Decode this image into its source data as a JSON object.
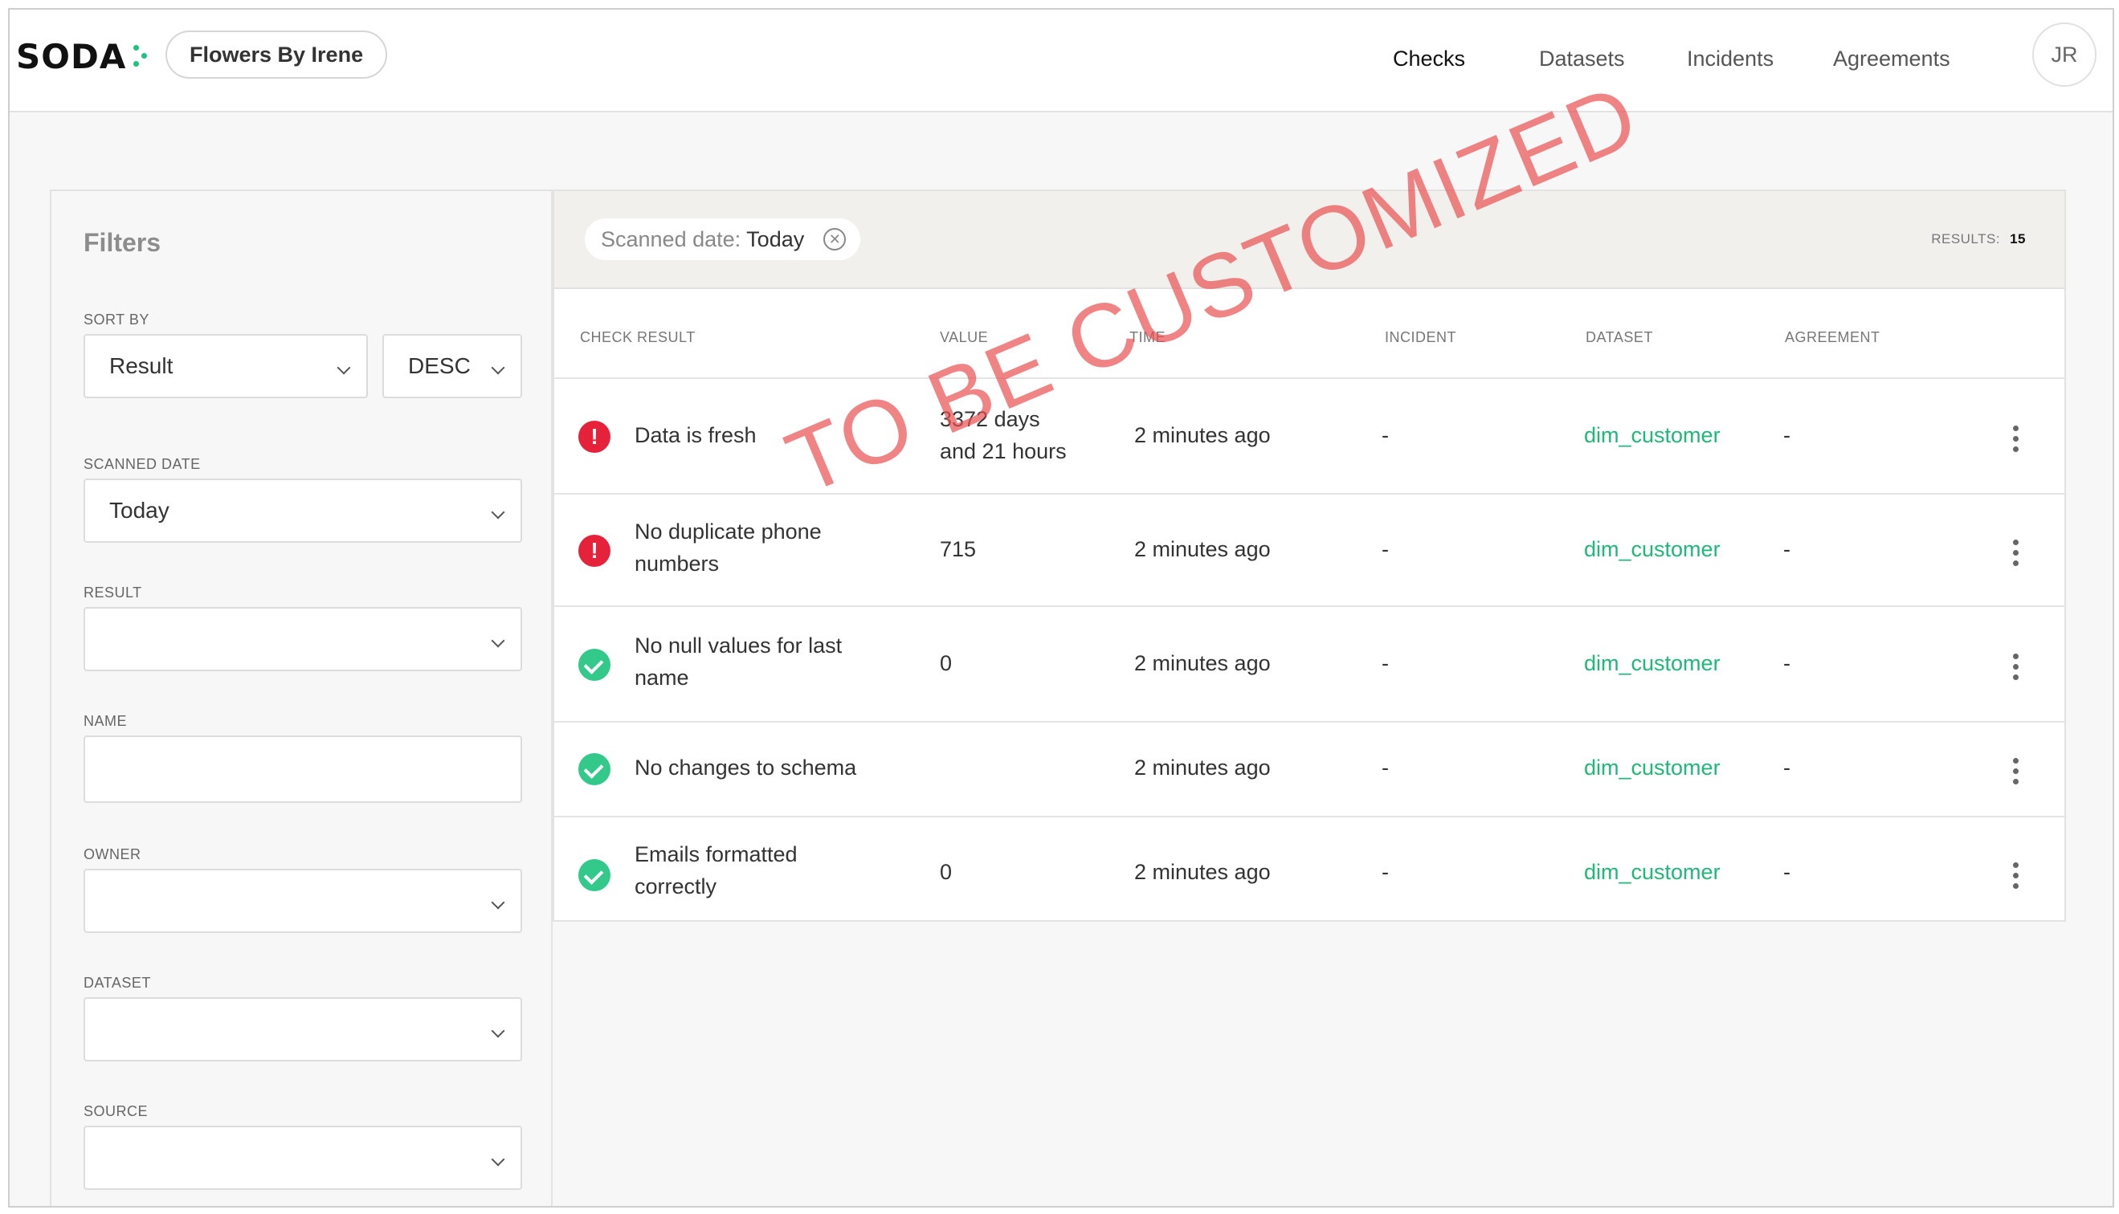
{
  "header": {
    "logo": "SODA",
    "org": "Flowers By Irene",
    "nav": [
      "Checks",
      "Datasets",
      "Incidents",
      "Agreements"
    ],
    "active_nav": "Checks",
    "avatar": "JR"
  },
  "filters": {
    "title": "Filters",
    "sort_by": {
      "label": "SORT BY",
      "field": "Result",
      "order": "DESC"
    },
    "scanned_date": {
      "label": "SCANNED DATE",
      "value": "Today"
    },
    "result": {
      "label": "RESULT",
      "value": ""
    },
    "name": {
      "label": "NAME",
      "value": ""
    },
    "owner": {
      "label": "OWNER",
      "value": ""
    },
    "dataset": {
      "label": "DATASET",
      "value": ""
    },
    "source": {
      "label": "SOURCE",
      "value": ""
    }
  },
  "results": {
    "chip": {
      "key": "Scanned date:",
      "value": "Today",
      "remove_icon": "close-circle-icon"
    },
    "count_label": "RESULTS:",
    "count": "15",
    "columns": [
      "CHECK RESULT",
      "VALUE",
      "TIME",
      "INCIDENT",
      "DATASET",
      "AGREEMENT"
    ],
    "rows": [
      {
        "status": "fail",
        "name_l1": "Data is fresh",
        "name_l2": "",
        "value_l1": "3372 days",
        "value_l2": "and 21 hours",
        "time": "2 minutes ago",
        "incident": "-",
        "dataset": "dim_customer",
        "agreement": "-"
      },
      {
        "status": "fail",
        "name_l1": "No duplicate phone",
        "name_l2": "numbers",
        "value_l1": "715",
        "value_l2": "",
        "time": "2 minutes ago",
        "incident": "-",
        "dataset": "dim_customer",
        "agreement": "-"
      },
      {
        "status": "pass",
        "name_l1": "No null values for last",
        "name_l2": "name",
        "value_l1": "0",
        "value_l2": "",
        "time": "2 minutes ago",
        "incident": "-",
        "dataset": "dim_customer",
        "agreement": "-"
      },
      {
        "status": "pass",
        "name_l1": "No changes to schema",
        "name_l2": "",
        "value_l1": "",
        "value_l2": "",
        "time": "2 minutes ago",
        "incident": "-",
        "dataset": "dim_customer",
        "agreement": "-"
      },
      {
        "status": "pass",
        "name_l1": "Emails formatted",
        "name_l2": "correctly",
        "value_l1": "0",
        "value_l2": "",
        "time": "2 minutes ago",
        "incident": "-",
        "dataset": "dim_customer",
        "agreement": "-"
      }
    ]
  },
  "watermark": "TO BE CUSTOMIZED",
  "colors": {
    "accent": "#1eb877",
    "fail": "#e5223a",
    "pass": "#32c98a",
    "watermark": "#e95050"
  }
}
